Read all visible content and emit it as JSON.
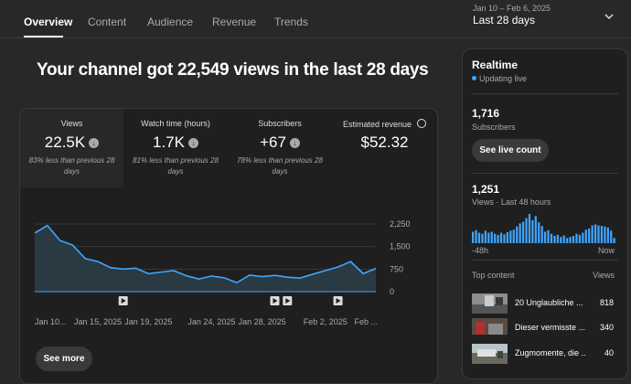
{
  "tabs": [
    "Overview",
    "Content",
    "Audience",
    "Revenue",
    "Trends"
  ],
  "date_range": {
    "dates": "Jan 10 – Feb 6, 2025",
    "label": "Last 28 days"
  },
  "headline": "Your channel got 22,549 views in the last 28 days",
  "metrics": [
    {
      "label": "Views",
      "value": "22.5K",
      "note": "83% less than previous 28 days",
      "trend_icon": "arrow-down-icon"
    },
    {
      "label": "Watch time (hours)",
      "value": "1.7K",
      "note": "81% less than previous 28 days",
      "trend_icon": "arrow-down-icon"
    },
    {
      "label": "Subscribers",
      "value": "+67",
      "note": "78% less than previous 28 days",
      "trend_icon": "arrow-down-icon"
    },
    {
      "label": "Estimated revenue",
      "value": "$52.32",
      "note": "",
      "trend_icon": "clock-icon"
    }
  ],
  "see_more": "See more",
  "chart_data": {
    "type": "area",
    "x": [
      "Jan 10",
      "Jan 11",
      "Jan 12",
      "Jan 13",
      "Jan 14",
      "Jan 15",
      "Jan 16",
      "Jan 17",
      "Jan 18",
      "Jan 19",
      "Jan 20",
      "Jan 21",
      "Jan 22",
      "Jan 23",
      "Jan 24",
      "Jan 25",
      "Jan 26",
      "Jan 27",
      "Jan 28",
      "Jan 29",
      "Jan 30",
      "Jan 31",
      "Feb 1",
      "Feb 2",
      "Feb 3",
      "Feb 4",
      "Feb 5",
      "Feb 6"
    ],
    "values": [
      1950,
      2200,
      1700,
      1550,
      1100,
      1000,
      800,
      750,
      780,
      600,
      650,
      700,
      530,
      420,
      520,
      460,
      300,
      550,
      500,
      540,
      480,
      450,
      580,
      700,
      820,
      1000,
      600,
      770
    ],
    "x_tick_labels": [
      "Jan 10...",
      "Jan 15, 2025",
      "Jan 19, 2025",
      "Jan 24, 2025",
      "Jan 28, 2025",
      "Feb 2, 2025",
      "Feb ..."
    ],
    "x_tick_dates": [
      "Jan 10",
      "Jan 15",
      "Jan 19",
      "Jan 24",
      "Jan 28",
      "Feb 2",
      "Feb 6"
    ],
    "y_ticks": [
      "2,250",
      "1,500",
      "750",
      "0"
    ],
    "ylim": [
      0,
      2250
    ],
    "color": "#3ea6ff",
    "video_markers": [
      "Jan 17",
      "Jan 29",
      "Jan 30",
      "Feb 3"
    ]
  },
  "realtime": {
    "title": "Realtime",
    "status": "Updating live",
    "subscribers": "1,716",
    "subscribers_label": "Subscribers",
    "live_button": "See live count",
    "views": "1,251",
    "views_label": "Views · Last 48 hours",
    "bars_start": "-48h",
    "bars_end": "Now",
    "bars": [
      22,
      25,
      20,
      18,
      24,
      20,
      22,
      18,
      16,
      20,
      17,
      21,
      24,
      26,
      32,
      38,
      41,
      48,
      56,
      44,
      52,
      40,
      33,
      22,
      25,
      18,
      14,
      16,
      12,
      15,
      10,
      12,
      14,
      18,
      16,
      20,
      26,
      28,
      34,
      36,
      34,
      33,
      32,
      30,
      24,
      10
    ],
    "top_content_label": "Top content",
    "top_content_col": "Views",
    "top_content": [
      {
        "title": "20 Unglaubliche ...",
        "views": "818"
      },
      {
        "title": "Dieser vermisste ...",
        "views": "340"
      },
      {
        "title": "Zugmomente, die ...",
        "views": "40"
      }
    ]
  }
}
